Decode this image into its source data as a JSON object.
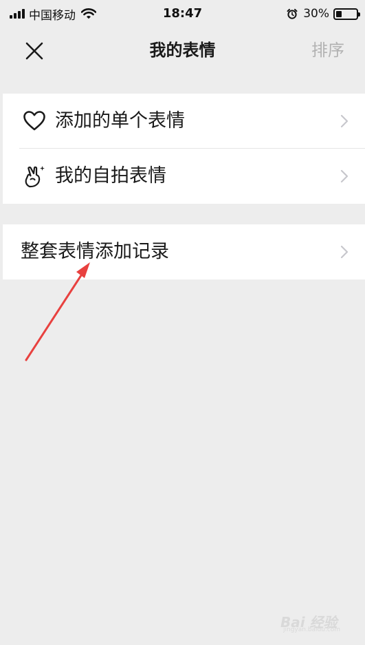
{
  "status_bar": {
    "carrier": "中国移动",
    "time": "18:47",
    "battery_percent": "30%",
    "battery_level": 0.3,
    "icons": [
      "signal-icon",
      "wifi-icon",
      "alarm-icon",
      "battery-icon"
    ]
  },
  "nav": {
    "title": "我的表情",
    "right_action": "排序",
    "close_icon": "close-icon"
  },
  "groups": [
    {
      "items": [
        {
          "label": "添加的单个表情",
          "icon": "heart-icon"
        },
        {
          "label": "我的自拍表情",
          "icon": "peace-hand-icon"
        }
      ]
    },
    {
      "items": [
        {
          "label": "整套表情添加记录",
          "icon": null
        }
      ]
    }
  ],
  "annotation": {
    "type": "red-arrow",
    "color": "#e8413f"
  },
  "watermark": {
    "text": "Bai 经验",
    "sub": "jingyan.baidu.com"
  },
  "colors": {
    "background": "#ededed",
    "cell_background": "#ffffff",
    "divider": "#e5e5e5",
    "text_primary": "#1a1a1a",
    "text_disabled": "#b2b2b2",
    "chevron": "#c7c7cc"
  }
}
